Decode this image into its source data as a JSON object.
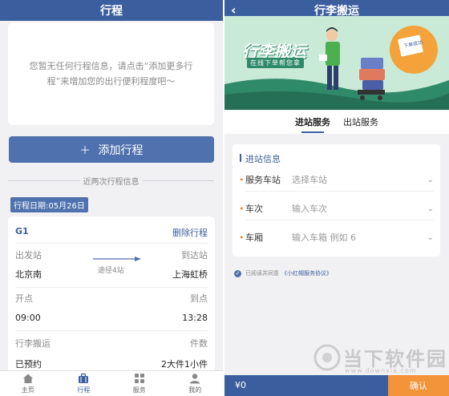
{
  "left": {
    "title": "行程",
    "empty_message": "您暂无任何行程信息，请点击“添加更多行程”来增加您的出行便利程度吧～",
    "add_button": "添加行程",
    "recent_label": "近两次行程信息",
    "trip_date": "行程日期:05月26日",
    "trip": {
      "train": "G1",
      "delete": "删除行程",
      "from_label": "出发站",
      "to_label": "到达站",
      "from": "北京南",
      "to": "上海虹桥",
      "via": "途径4站",
      "depart_label": "开点",
      "arrive_label": "到点",
      "depart": "09:00",
      "arrive": "13:28",
      "luggage_label": "行李搬运",
      "pieces_label": "件数",
      "luggage": "已预约",
      "pieces": "2大件1小件"
    },
    "tabs": [
      {
        "label": "主页",
        "icon": "home-icon"
      },
      {
        "label": "行程",
        "icon": "suitcase-icon"
      },
      {
        "label": "服务",
        "icon": "grid-icon"
      },
      {
        "label": "我的",
        "icon": "user-icon"
      }
    ],
    "active_tab": 1
  },
  "right": {
    "title": "行李搬运",
    "banner_title": "行李搬运",
    "banner_sub": "在线下单帮您拿",
    "banner_note": "下单成功",
    "service_tabs": [
      "进站服务",
      "出站服务"
    ],
    "active_service": 0,
    "form_title": "进站信息",
    "fields": [
      {
        "label": "服务车站",
        "placeholder": "选择车站"
      },
      {
        "label": "车次",
        "placeholder": "输入车次"
      },
      {
        "label": "车厢",
        "placeholder": "输入车箱 例如 6"
      }
    ],
    "agree_text": "已阅读并同意",
    "agree_link": "《小红帽服务协议》",
    "price": "¥0",
    "confirm": "确认"
  },
  "watermark": {
    "text": "当下软件园",
    "url": "www.downxia.com"
  },
  "colors": {
    "primary": "#3b5f9e",
    "button": "#4f72ae",
    "accent": "#f3933a",
    "banner_bg": "#c9ead7"
  }
}
